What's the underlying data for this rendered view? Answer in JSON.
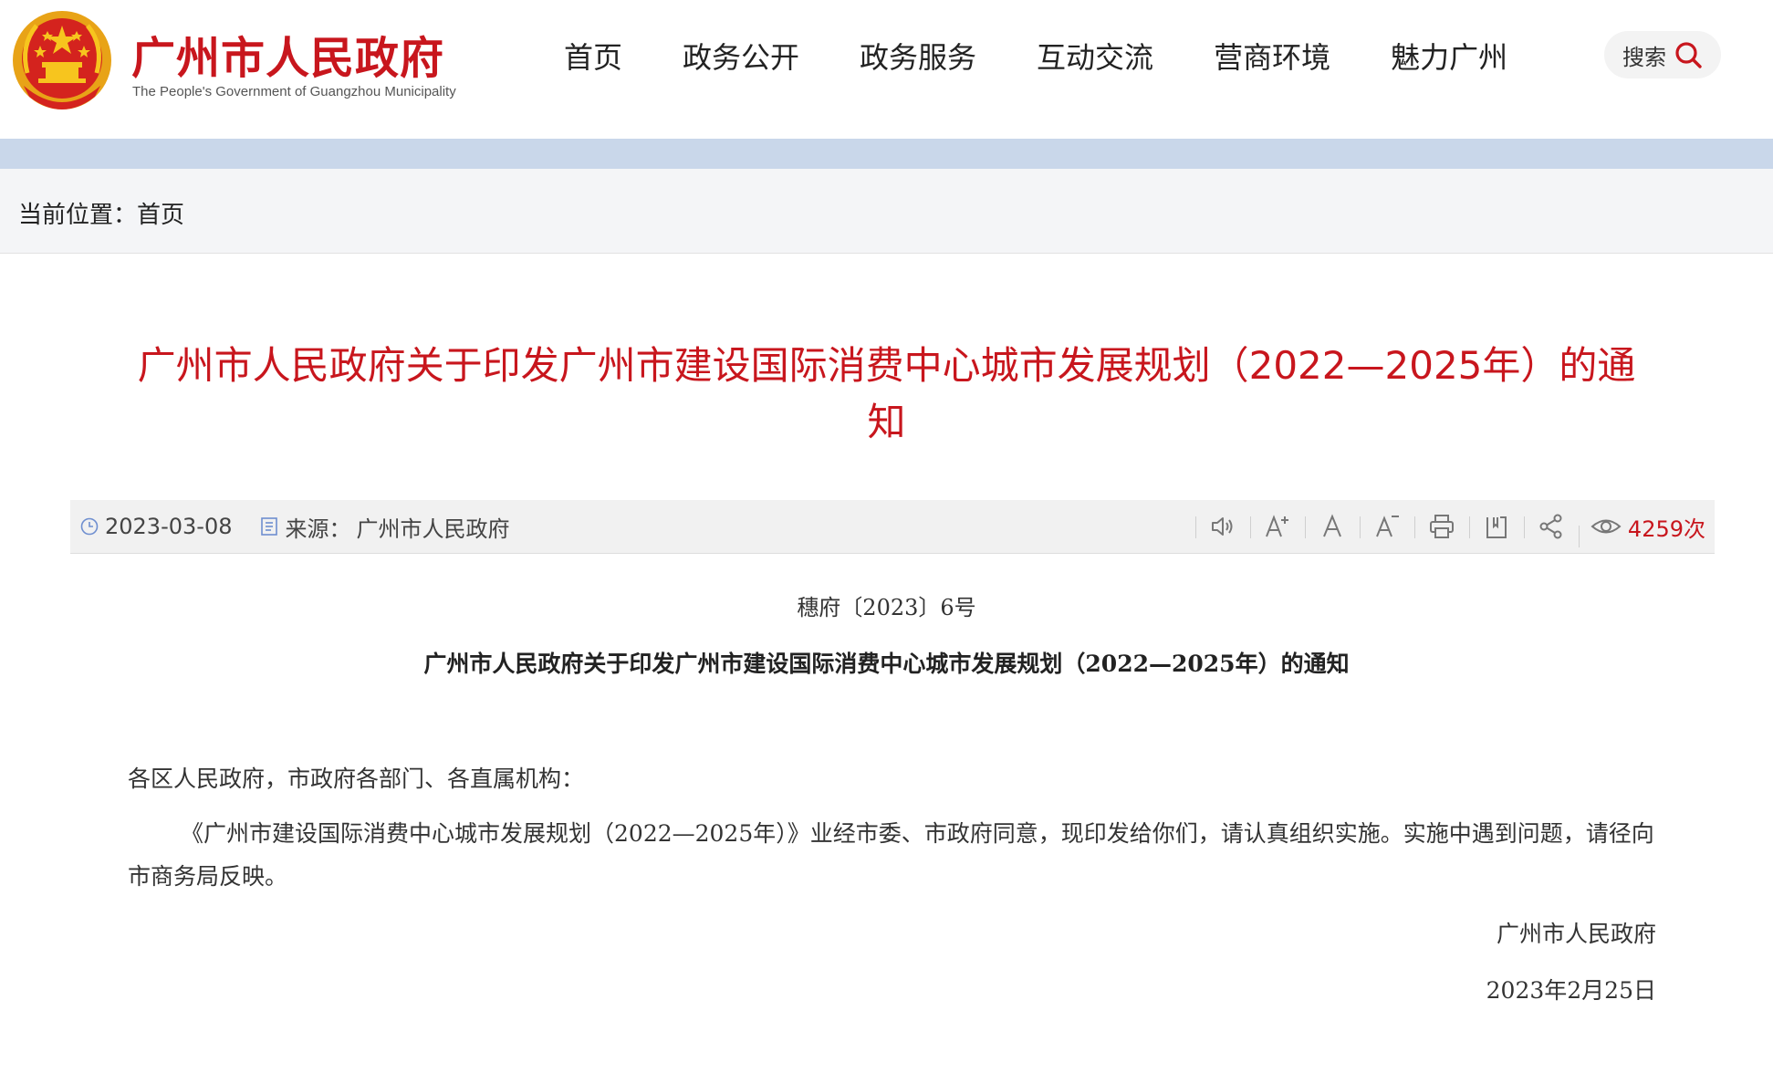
{
  "header": {
    "site_title": "广州市人民政府",
    "site_subtitle": "The People's Government of Guangzhou Municipality",
    "nav": [
      "首页",
      "政务公开",
      "政务服务",
      "互动交流",
      "营商环境",
      "魅力广州"
    ],
    "search_label": "搜索"
  },
  "breadcrumb": {
    "prefix": "当前位置：",
    "home": "首页"
  },
  "article": {
    "title": "广州市人民政府关于印发广州市建设国际消费中心城市发展规划（2022—2025年）的通知",
    "date": "2023-03-08",
    "source_label": "来源：",
    "source": "广州市人民政府",
    "views": "4259次",
    "doc_number": "穗府〔2023〕6号",
    "doc_title": "广州市人民政府关于印发广州市建设国际消费中心城市发展规划（2022—2025年）的通知",
    "salutation": "各区人民政府，市政府各部门、各直属机构：",
    "body": "《广州市建设国际消费中心城市发展规划（2022—2025年）》业经市委、市政府同意，现印发给你们，请认真组织实施。实施中遇到问题，请径向市商务局反映。",
    "signature_org": "广州市人民政府",
    "signature_date": "2023年2月25日"
  },
  "tools": [
    "audio-icon",
    "font-increase-icon",
    "font-reset-icon",
    "font-decrease-icon",
    "print-icon",
    "bookmark-icon",
    "share-icon",
    "eye-icon"
  ],
  "colors": {
    "brand_red": "#c8161d",
    "banner_blue": "#c9d7ea",
    "breadcrumb_bg": "#f4f5f7",
    "meta_bg": "#f1f1f1"
  }
}
